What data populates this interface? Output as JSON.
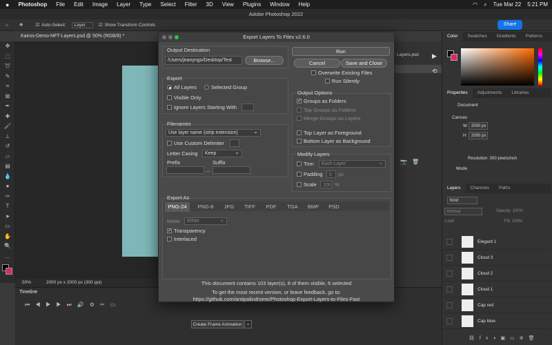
{
  "menubar": {
    "apple": "",
    "items": [
      "Photoshop",
      "File",
      "Edit",
      "Image",
      "Layer",
      "Type",
      "Select",
      "Filter",
      "3D",
      "View",
      "Plugins",
      "Window",
      "Help"
    ],
    "date": "Tue Mar 22",
    "time": "5:21 PM"
  },
  "window_title": "Adobe Photoshop 2022",
  "options_bar": {
    "auto_select": "Auto-Select:",
    "layer_value": "Layer",
    "transform": "Show Transform Controls",
    "share": "Share"
  },
  "document": {
    "tab": "Kairos-Demo-NFT-Layers.psd @ 50% (RGB/8) *",
    "zoom": "50%",
    "size": "2000 px x 2000 px (300 ppi)"
  },
  "timeline": {
    "title": "Timeline",
    "create_button": "Create Frame Animation"
  },
  "right_panels": {
    "color_tabs": [
      "Color",
      "Swatches",
      "Gradients",
      "Patterns"
    ],
    "prop_tabs": [
      "Properties",
      "Adjustments",
      "Libraries"
    ],
    "document_label": "Document",
    "canvas_label": "Canvas",
    "w_label": "W",
    "w_value": "2000 px",
    "h_label": "H",
    "h_value": "2000 px",
    "resolution": "Resolution: 300 pixels/inch",
    "mode": "Mode",
    "layers_tabs": [
      "Layers",
      "Channels",
      "Paths"
    ],
    "kind": "Kind",
    "blend": "Normal",
    "opacity": "Opacity: 100%",
    "lock": "Lock:",
    "fill": "Fill: 100%",
    "layers": [
      "Elegant 1",
      "Cloud 3",
      "Cloud 2",
      "Cloud 1",
      "Cap red",
      "Cap blue"
    ],
    "middle_tab": "Layers.psd"
  },
  "dialog": {
    "title": "Export Layers To Files v2.6.0",
    "output_destination": {
      "label": "Output Destination",
      "path": "/Users/jeanyngo/Desktop/Test",
      "browse": "Browse..."
    },
    "buttons": {
      "run": "Run",
      "cancel": "Cancel",
      "save_close": "Save and Close"
    },
    "overwrite": "Overwrite Existing Files",
    "run_silently": "Run Silently",
    "export": {
      "label": "Export",
      "all_layers": "All Layers",
      "selected_group": "Selected Group",
      "visible_only": "Visible Only",
      "ignore_starting": "Ignore Layers Starting With"
    },
    "output_options": {
      "label": "Output Options",
      "groups_as_folders": "Groups as Folders",
      "top_groups": "Top Groups as Folders",
      "merge_groups": "Merge Groups as Layers",
      "top_layer_fg": "Top Layer as Foreground",
      "bottom_layer_bg": "Bottom Layer as Background"
    },
    "filenames": {
      "label": "Filenames",
      "naming": "Use layer name (strip extension)",
      "custom_delimiter": "Use Custom Delimiter",
      "letter_casing": "Letter Casing",
      "casing_value": "Keep",
      "prefix": "Prefix",
      "suffix": "Suffix",
      "ellipsis": "..."
    },
    "modify_layers": {
      "label": "Modify Layers",
      "trim": "Trim",
      "trim_value": "Each Layer",
      "padding": "Padding",
      "padding_value": "0",
      "padding_unit": "px",
      "scale": "Scale",
      "scale_value": "100",
      "scale_unit": "%"
    },
    "export_as": {
      "label": "Export As",
      "tabs": [
        "PNG-24",
        "PNG-8",
        "JPG",
        "TIFF",
        "PDF",
        "TGA",
        "BMP",
        "PSD"
      ],
      "matte": "Matte",
      "matte_value": "White",
      "transparency": "Transparency",
      "interlaced": "Interlaced"
    },
    "footer": {
      "summary": "This document contains 103 layer(s), 8 of them visible, 6 selected",
      "feedback": "To get the most recent version, or leave feedback, go to:",
      "url": "https://github.com/antipalindrome/Photoshop-Export-Layers-to-Files-Fast"
    }
  }
}
